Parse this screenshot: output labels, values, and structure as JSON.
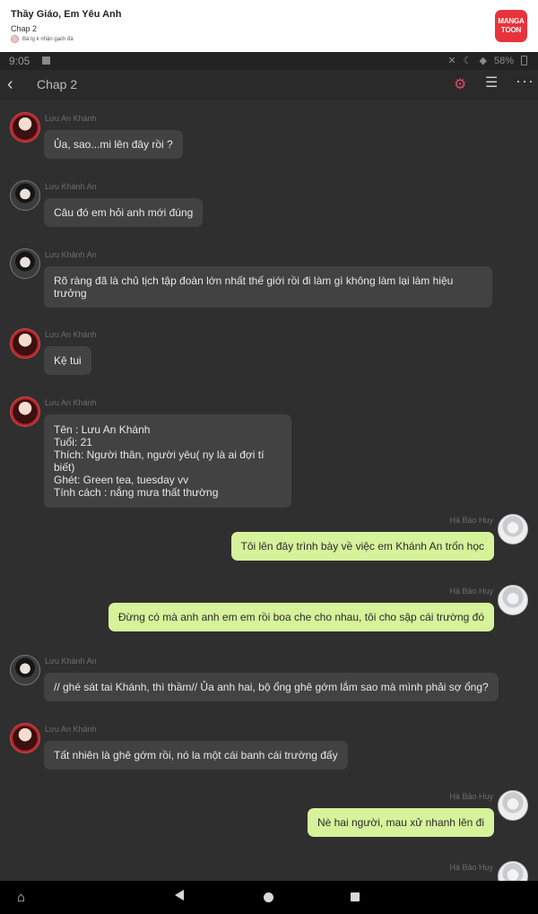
{
  "header": {
    "title": "Thầy Giáo, Em Yêu Anh",
    "chapter": "Chap 2",
    "author": "Bà tg k nhận gạch đá",
    "logo_line1": "MANGA",
    "logo_line2": "TOON",
    "brand_color": "#e8333c"
  },
  "status_bar": {
    "time": "9:05",
    "battery": "58%"
  },
  "app_bar": {
    "title": "Chap 2",
    "accent_color": "#e2456a"
  },
  "messages": [
    {
      "speaker": "Lưu An Khánh",
      "text": "Ủa, sao...mi lên đây rồi ?"
    },
    {
      "speaker": "Lưu Khánh An",
      "text": "Câu đó em hỏi anh mới đúng"
    },
    {
      "speaker": "Lưu Khánh An",
      "text_line1": "Rõ ràng đã là chủ tịch tập đoàn lớn nhất thế giới rồi đi làm gì không làm lại làm hiệu",
      "text_line2": "trưởng"
    },
    {
      "speaker": "Lưu An Khánh",
      "text": "Kệ tui"
    },
    {
      "speaker": "Lưu An Khánh",
      "lines": [
        "Tên : Lưu An Khánh",
        "Tuổi: 21",
        "Thích: Người thân, người yêu( ny là ai đợi tí biết)",
        "Ghét: Green tea, tuesday vv",
        "Tính cách : nắng mưa thất thường"
      ]
    },
    {
      "speaker": "Hà Bảo Huy",
      "text": "Tôi lên đây trình bày về việc em Khánh An trốn học"
    },
    {
      "speaker": "Hà Bảo Huy",
      "text": "Đừng có mà anh anh em em rồi boa che cho nhau, tôi cho sập cái trường đó"
    },
    {
      "speaker": "Lưu Khánh An",
      "text": "// ghé sát tai Khánh, thì thầm// Ủa anh hai, bộ ổng ghê gớm lắm sao mà mình phải sợ ổng?"
    },
    {
      "speaker": "Lưu An Khánh",
      "text": "Tất nhiên là ghê gớm rồi, nó la một cái banh cái trường đấy"
    },
    {
      "speaker": "Hà Bảo Huy",
      "text": "Nè hai người, mau xử nhanh lên đi"
    },
    {
      "speaker": "Hà Bảo Huy"
    }
  ],
  "bubble_colors": {
    "incoming": "#424242",
    "outgoing": "#d6f29a"
  }
}
